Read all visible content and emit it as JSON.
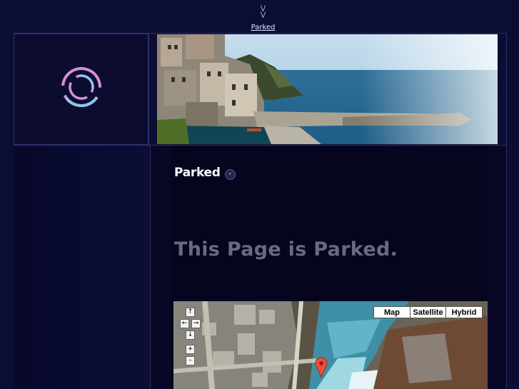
{
  "top_nav": {
    "link_label": "Parked"
  },
  "content": {
    "heading": "Parked",
    "message": "This Page is Parked."
  },
  "map": {
    "types": [
      "Map",
      "Satellite",
      "Hybrid"
    ],
    "controls": {
      "up": "↑",
      "left": "←",
      "right": "→",
      "down": "↓",
      "zoom_in": "+",
      "zoom_out": "–"
    }
  },
  "colors": {
    "background": "#0c0d33",
    "message": "#686b80",
    "ring_pink": "#d88cd8",
    "ring_blue": "#8cc4ec"
  }
}
